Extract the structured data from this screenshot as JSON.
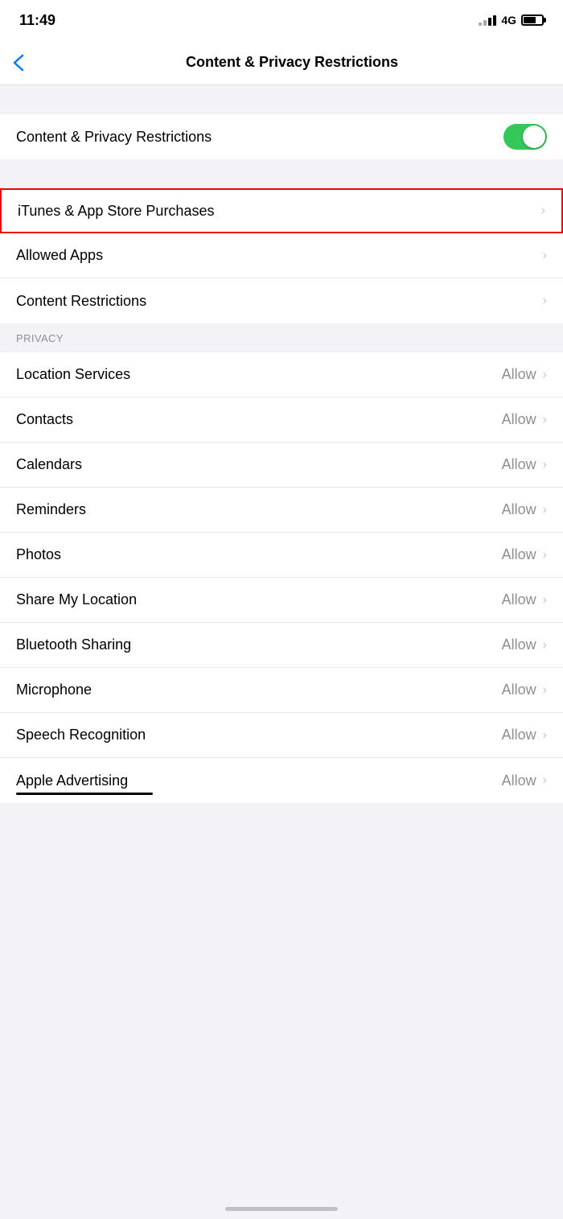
{
  "statusBar": {
    "time": "11:49",
    "network": "4G"
  },
  "navBar": {
    "backLabel": "‹",
    "title": "Content & Privacy Restrictions"
  },
  "mainToggleRow": {
    "label": "Content & Privacy Restrictions",
    "enabled": true
  },
  "allowedSection": {
    "rows": [
      {
        "label": "iTunes & App Store Purchases",
        "value": "",
        "highlighted": true
      },
      {
        "label": "Allowed Apps",
        "value": ""
      },
      {
        "label": "Content Restrictions",
        "value": ""
      }
    ]
  },
  "privacySection": {
    "header": "PRIVACY",
    "rows": [
      {
        "label": "Location Services",
        "value": "Allow"
      },
      {
        "label": "Contacts",
        "value": "Allow"
      },
      {
        "label": "Calendars",
        "value": "Allow"
      },
      {
        "label": "Reminders",
        "value": "Allow"
      },
      {
        "label": "Photos",
        "value": "Allow"
      },
      {
        "label": "Share My Location",
        "value": "Allow"
      },
      {
        "label": "Bluetooth Sharing",
        "value": "Allow"
      },
      {
        "label": "Microphone",
        "value": "Allow"
      },
      {
        "label": "Speech Recognition",
        "value": "Allow"
      },
      {
        "label": "Apple Advertising",
        "value": "Allow"
      }
    ]
  }
}
